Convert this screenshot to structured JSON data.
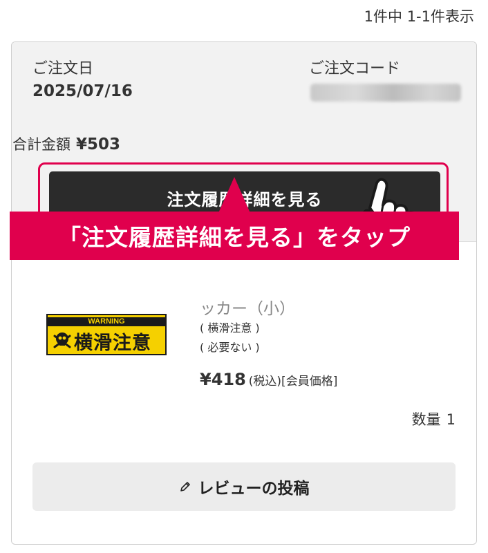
{
  "summary": {
    "count_text": "1件中 1-1件表示"
  },
  "order": {
    "date_label": "ご注文日",
    "date_value": "2025/07/16",
    "code_label": "ご注文コード",
    "total_label": "合計金額",
    "total_value": "¥503",
    "detail_button_label": "注文履歴詳細を見る"
  },
  "callout": {
    "text": "「注文履歴詳細を見る」をタップ",
    "color": "#e0004d"
  },
  "item": {
    "name_partial": "ッカー（小）",
    "thumbnail": {
      "warning_text": "WARNING",
      "main_text": "横滑注意"
    },
    "options": [
      "( 横滑注意 )",
      "( 必要ない )"
    ],
    "price_value": "¥418",
    "price_note": "(税込)[会員価格]",
    "quantity_label": "数量",
    "quantity_value": "1"
  },
  "review": {
    "button_label": "レビューの投稿",
    "icon": "pencil-icon"
  },
  "colors": {
    "button_dark": "#2b2b2b",
    "accent": "#e0004d",
    "header_bg": "#f2f2f2"
  }
}
